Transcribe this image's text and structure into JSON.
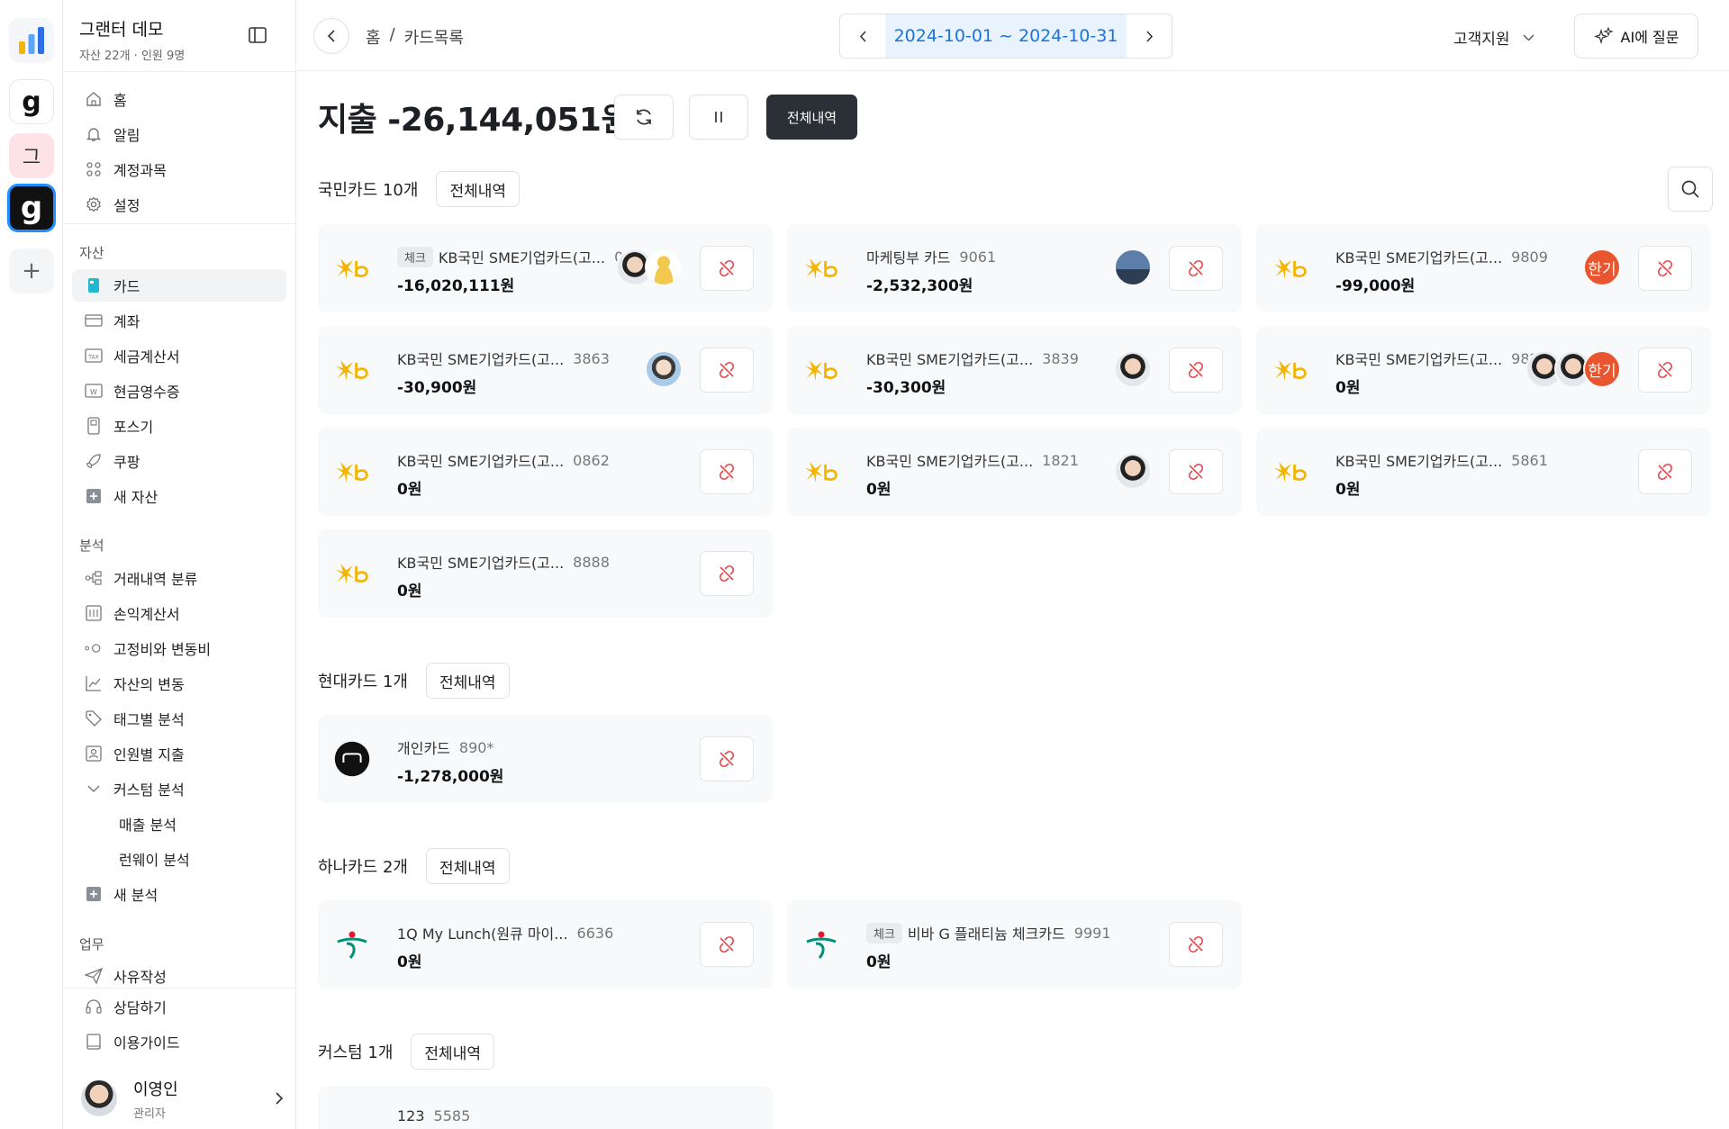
{
  "rail": {
    "workspaces": [
      "g",
      "그",
      "g"
    ],
    "add_label": "+"
  },
  "sidebar": {
    "org_name": "그랜터 데모",
    "org_sub": "자산 22개 · 인원 9명",
    "main_items": [
      {
        "label": "홈",
        "icon": "home-icon"
      },
      {
        "label": "알림",
        "icon": "bell-icon"
      },
      {
        "label": "계정과목",
        "icon": "grid-icon"
      },
      {
        "label": "설정",
        "icon": "gear-icon"
      }
    ],
    "assets_label": "자산",
    "asset_items": [
      {
        "label": "카드",
        "icon": "card-icon"
      },
      {
        "label": "계좌",
        "icon": "bank-icon"
      },
      {
        "label": "세금계산서",
        "icon": "tax-icon"
      },
      {
        "label": "현금영수증",
        "icon": "receipt-icon"
      },
      {
        "label": "포스기",
        "icon": "pos-icon"
      },
      {
        "label": "쿠팡",
        "icon": "rocket-icon"
      },
      {
        "label": "새 자산",
        "icon": "plus-icon"
      }
    ],
    "analysis_label": "분석",
    "analysis_items": [
      {
        "label": "거래내역 분류",
        "icon": "flow-icon"
      },
      {
        "label": "손익계산서",
        "icon": "ledger-icon"
      },
      {
        "label": "고정비와 변동비",
        "icon": "circles-icon"
      },
      {
        "label": "자산의 변동",
        "icon": "chart-icon"
      },
      {
        "label": "태그별 분석",
        "icon": "tag-icon"
      },
      {
        "label": "인원별 지출",
        "icon": "person-icon"
      },
      {
        "label": "커스텀 분석",
        "icon": "chevron-down-icon"
      },
      {
        "label": "매출 분석",
        "icon": ""
      },
      {
        "label": "런웨이 분석",
        "icon": ""
      },
      {
        "label": "새 분석",
        "icon": "plus-icon"
      }
    ],
    "work_label": "업무",
    "work_items": [
      {
        "label": "사유작성",
        "icon": "send-icon"
      }
    ],
    "bottom_items": [
      {
        "label": "상담하기",
        "icon": "headset-icon"
      },
      {
        "label": "이용가이드",
        "icon": "book-icon"
      }
    ],
    "user": {
      "name": "이영인",
      "role": "관리자"
    }
  },
  "topbar": {
    "breadcrumb": [
      "홈",
      "/",
      "카드목록"
    ],
    "date_range": "2024-10-01 ~ 2024-10-31",
    "support_label": "고객지원",
    "ai_label": "AI에 질문"
  },
  "main": {
    "headline": "지출 -26,144,051원",
    "all_history_label": "전체내역",
    "groups": [
      {
        "title": "국민카드 10개",
        "button": "전체내역"
      },
      {
        "title": "현대카드 1개",
        "button": "전체내역"
      },
      {
        "title": "하나카드 2개",
        "button": "전체내역"
      },
      {
        "title": "커스텀 1개",
        "button": "전체내역"
      }
    ],
    "cards": [
      {
        "chip": "체크",
        "name": "KB국민 SME기업카드(고...",
        "num": "0(",
        "amount": "-16,020,111원",
        "brand": "kb"
      },
      {
        "chip": "",
        "name": "마케팅부 카드",
        "num": "9061",
        "amount": "-2,532,300원",
        "brand": "kb"
      },
      {
        "chip": "",
        "name": "KB국민 SME기업카드(고...",
        "num": "9809",
        "amount": "-99,000원",
        "brand": "kb",
        "badge": "한기"
      },
      {
        "chip": "",
        "name": "KB국민 SME기업카드(고...",
        "num": "3863",
        "amount": "-30,900원",
        "brand": "kb"
      },
      {
        "chip": "",
        "name": "KB국민 SME기업카드(고...",
        "num": "3839",
        "amount": "-30,300원",
        "brand": "kb"
      },
      {
        "chip": "",
        "name": "KB국민 SME기업카드(고...",
        "num": "982",
        "amount": "0원",
        "brand": "kb",
        "badge": "한기"
      },
      {
        "chip": "",
        "name": "KB국민 SME기업카드(고...",
        "num": "0862",
        "amount": "0원",
        "brand": "kb"
      },
      {
        "chip": "",
        "name": "KB국민 SME기업카드(고...",
        "num": "1821",
        "amount": "0원",
        "brand": "kb"
      },
      {
        "chip": "",
        "name": "KB국민 SME기업카드(고...",
        "num": "5861",
        "amount": "0원",
        "brand": "kb"
      },
      {
        "chip": "",
        "name": "KB국민 SME기업카드(고...",
        "num": "8888",
        "amount": "0원",
        "brand": "kb"
      },
      {
        "chip": "",
        "name": "개인카드",
        "num": "890*",
        "amount": "-1,278,000원",
        "brand": "hyundai"
      },
      {
        "chip": "",
        "name": "1Q My Lunch(원큐 마이...",
        "num": "6636",
        "amount": "0원",
        "brand": "hana"
      },
      {
        "chip": "체크",
        "name": "비바 G 플래티늄 체크카드",
        "num": "9991",
        "amount": "0원",
        "brand": "hana"
      },
      {
        "chip": "",
        "name": "123",
        "num": "5585",
        "amount": "",
        "brand": "custom"
      }
    ],
    "colors": {
      "kb_yellow": "#f5b400",
      "hana_green": "#009178",
      "hana_red": "#e8152e",
      "unlink_red": "#e5484d",
      "date_blue": "#1d74d8"
    }
  }
}
